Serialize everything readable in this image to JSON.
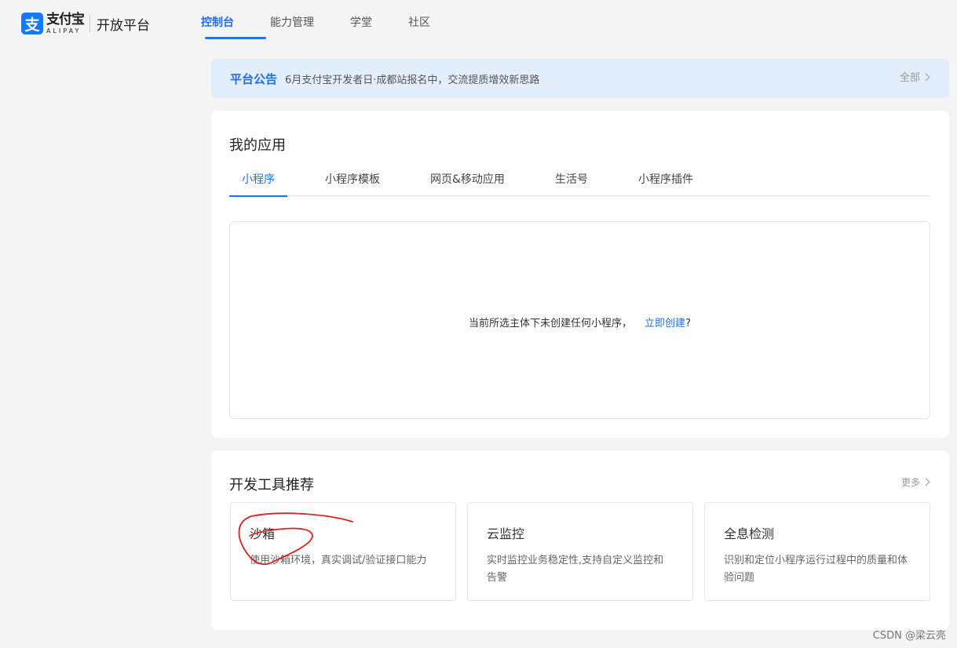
{
  "header": {
    "logo_mark": "支",
    "logo_cn": "支付宝",
    "logo_en": "ALIPAY",
    "platform": "开放平台",
    "nav": [
      "控制台",
      "能力管理",
      "学堂",
      "社区"
    ]
  },
  "notice": {
    "tag": "平台公告",
    "text": "6月支付宝开发者日·成都站报名中，交流提质增效新思路",
    "all_link": "全部"
  },
  "my_apps": {
    "title": "我的应用",
    "tabs": [
      "小程序",
      "小程序模板",
      "网页&移动应用",
      "生活号",
      "小程序插件"
    ],
    "empty_text": "当前所选主体下未创建任何小程序，",
    "create_link": "立即创建",
    "create_suffix": "?"
  },
  "dev_tools": {
    "title": "开发工具推荐",
    "more": "更多",
    "items": [
      {
        "name": "沙箱",
        "desc": "使用沙箱环境，真实调试/验证接口能力"
      },
      {
        "name": "云监控",
        "desc": "实时监控业务稳定性,支持自定义监控和告警"
      },
      {
        "name": "全息检测",
        "desc": "识别和定位小程序运行过程中的质量和体验问题"
      }
    ]
  },
  "watermark": "CSDN @梁云亮",
  "colors": {
    "accent": "#1677ff",
    "annotation": "#e02020",
    "notice_bg": "#e3eefc"
  }
}
